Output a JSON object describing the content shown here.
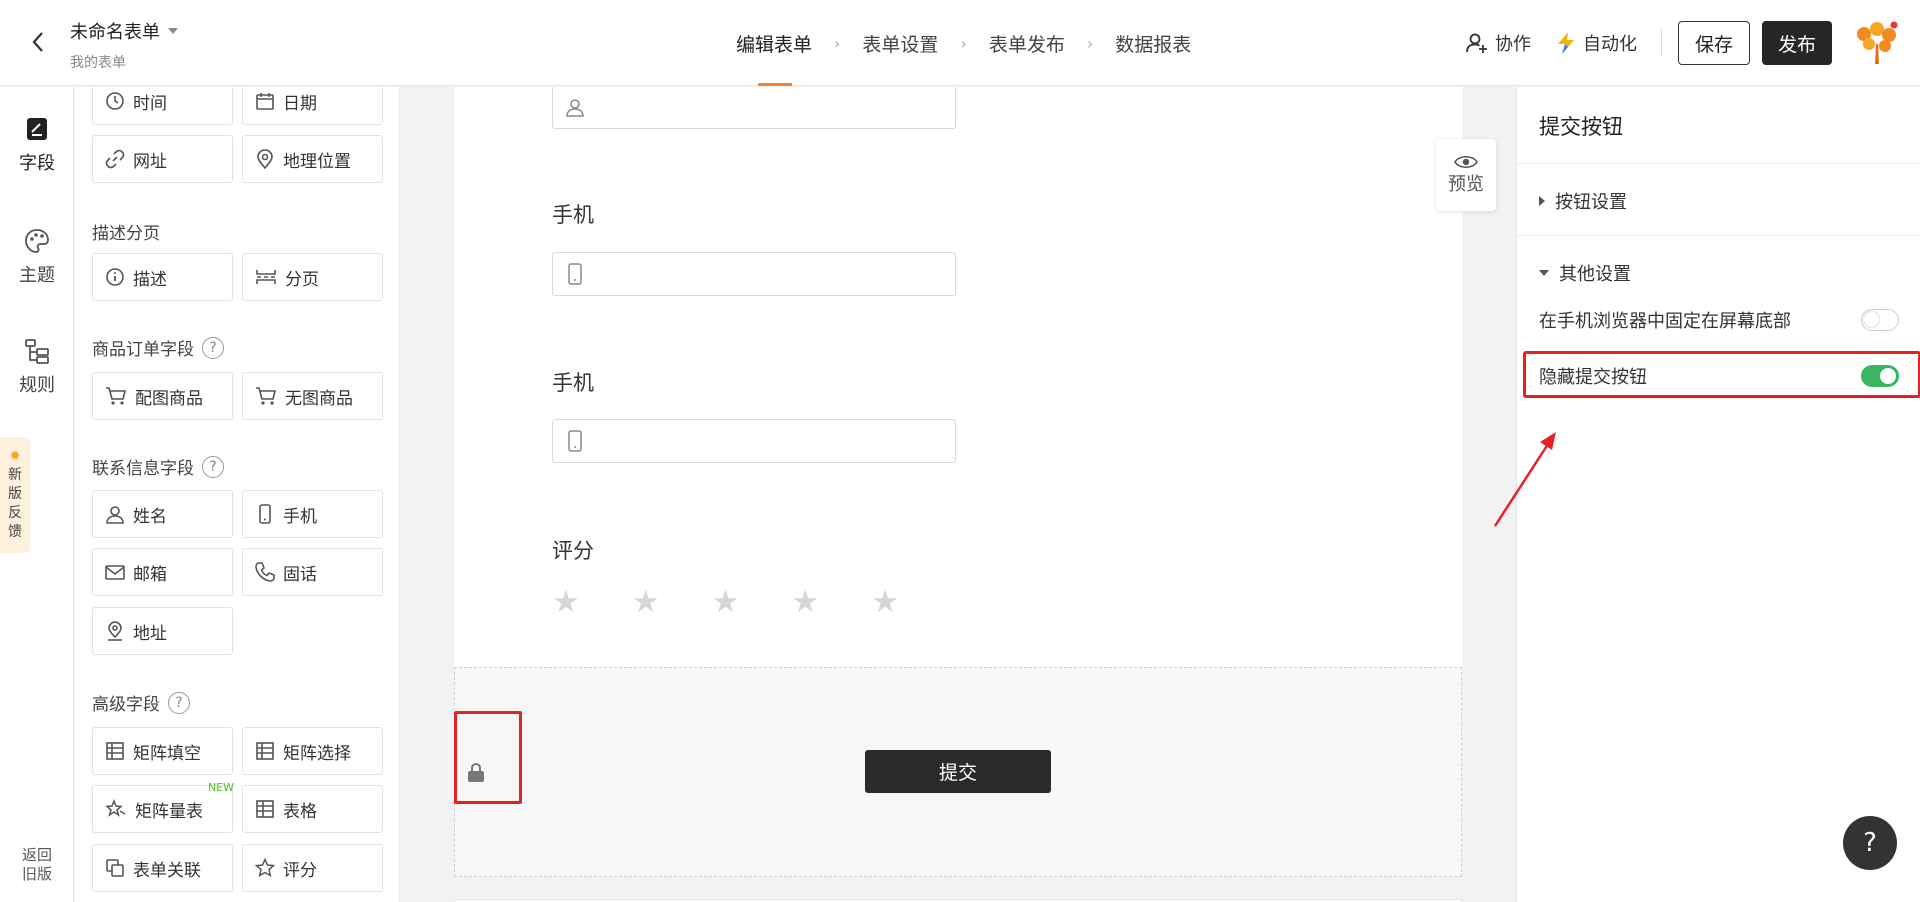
{
  "header": {
    "form_title": "未命名表单",
    "form_subtitle": "我的表单",
    "steps": [
      "编辑表单",
      "表单设置",
      "表单发布",
      "数据报表"
    ],
    "collab_label": "协作",
    "automation_label": "自动化",
    "save_label": "保存",
    "publish_label": "发布"
  },
  "leftnav": {
    "items": [
      "字段",
      "主题",
      "规则"
    ],
    "feedback": [
      "新",
      "版",
      "反",
      "馈"
    ],
    "old_version": [
      "返回",
      "旧版"
    ]
  },
  "palette": {
    "row0": [
      "时间",
      "日期"
    ],
    "row1": [
      "网址",
      "地理位置"
    ],
    "group_desc": "描述分页",
    "desc_items": [
      "描述",
      "分页"
    ],
    "group_goods": "商品订单字段",
    "goods_items": [
      "配图商品",
      "无图商品"
    ],
    "group_contact": "联系信息字段",
    "contact_items": [
      "姓名",
      "手机",
      "邮箱",
      "固话",
      "地址"
    ],
    "group_advanced": "高级字段",
    "advanced_items": [
      "矩阵填空",
      "矩阵选择",
      "矩阵量表",
      "表格",
      "表单关联",
      "评分"
    ],
    "new_tag": "NEW"
  },
  "canvas": {
    "field_phone_1": "手机",
    "field_phone_2": "手机",
    "field_rating": "评分",
    "preview_label": "预览",
    "submit_label": "提交",
    "rating_stars": 5
  },
  "rightpanel": {
    "title": "提交按钮",
    "section_button": "按钮设置",
    "section_other": "其他设置",
    "opt_fix_bottom": "在手机浏览器中固定在屏幕底部",
    "opt_fix_bottom_on": false,
    "opt_hide_submit": "隐藏提交按钮",
    "opt_hide_submit_on": true
  },
  "help_fab": "?",
  "colors": {
    "accent": "#f7852e",
    "toggle_on": "#3cb563",
    "annotation_red": "#e52222",
    "dark_button": "#262626"
  }
}
